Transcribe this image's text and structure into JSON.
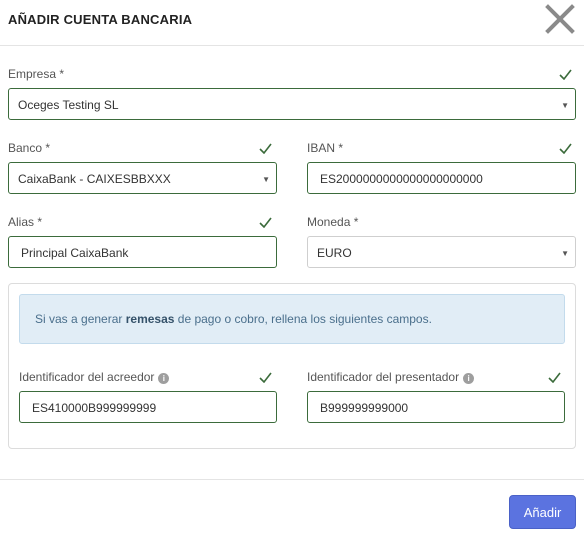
{
  "modal": {
    "title": "AÑADIR CUENTA BANCARIA",
    "close_icon": "close-icon"
  },
  "form": {
    "empresa": {
      "label": "Empresa *",
      "value": "Oceges Testing SL",
      "valid": true
    },
    "banco": {
      "label": "Banco *",
      "value": "CaixaBank - CAIXESBBXXX",
      "valid": true
    },
    "iban": {
      "label": "IBAN *",
      "value": "ES2000000000000000000000",
      "valid": true
    },
    "alias": {
      "label": "Alias *",
      "value": "Principal CaixaBank",
      "valid": true
    },
    "moneda": {
      "label": "Moneda *",
      "value": "EURO"
    }
  },
  "remesas": {
    "info_prefix": "Si vas a generar ",
    "info_bold": "remesas",
    "info_suffix": " de pago o cobro, rellena los siguientes campos.",
    "acreedor": {
      "label": "Identificador del acreedor",
      "value": "ES410000B999999999",
      "valid": true,
      "info_icon": "info-icon"
    },
    "presentador": {
      "label": "Identificador del presentador",
      "value": "B999999999000",
      "valid": true,
      "info_icon": "info-icon"
    }
  },
  "footer": {
    "add_label": "Añadir"
  },
  "colors": {
    "accent": "#5b73e0",
    "valid": "#3b6b3b",
    "info_bg": "#e1edf6"
  }
}
